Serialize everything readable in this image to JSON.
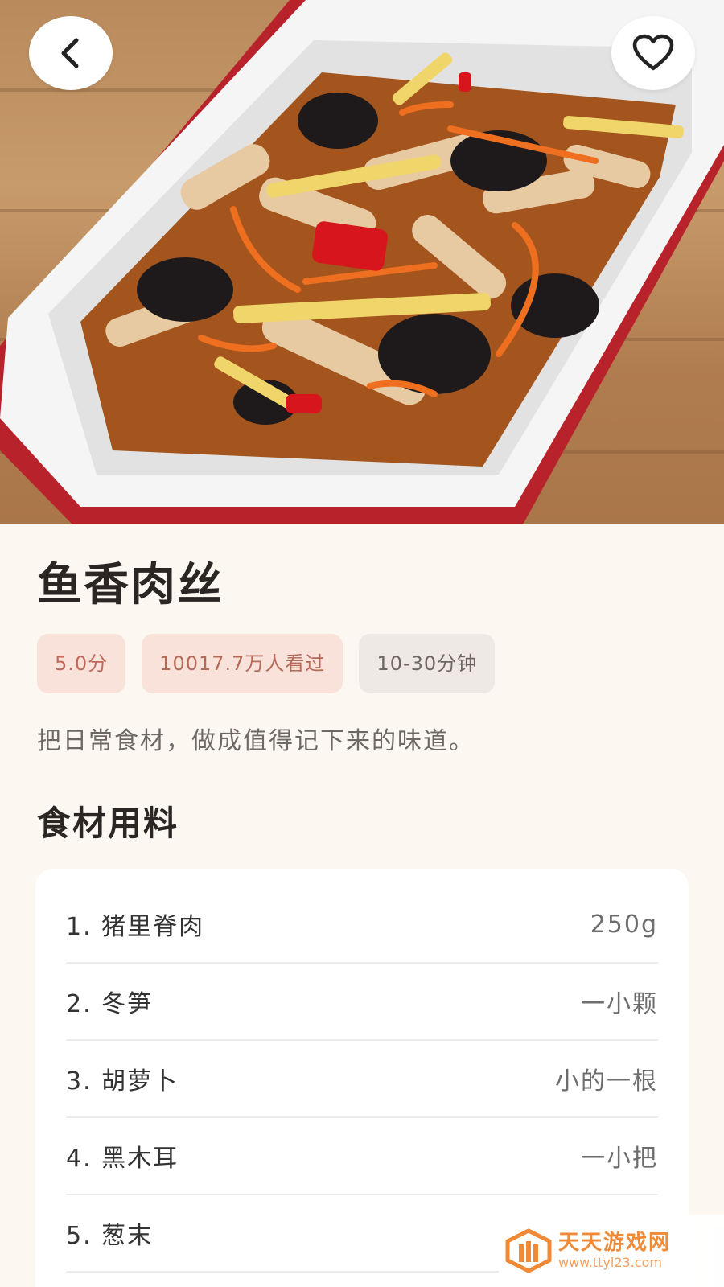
{
  "hero": {
    "image_alt": "鱼香肉丝"
  },
  "nav": {
    "back_icon": "chevron-left-icon",
    "favorite_icon": "heart-outline-icon"
  },
  "recipe": {
    "title": "鱼香肉丝",
    "tags": {
      "score": "5.0分",
      "views": "10017.7万人看过",
      "time": "10-30分钟"
    },
    "description": "把日常食材，做成值得记下来的味道。"
  },
  "ingredients": {
    "section_title": "食材用料",
    "items": [
      {
        "name": "1. 猪里脊肉",
        "amount": "250g"
      },
      {
        "name": "2. 冬笋",
        "amount": "一小颗"
      },
      {
        "name": "3. 胡萝卜",
        "amount": "小的一根"
      },
      {
        "name": "4. 黑木耳",
        "amount": "一小把"
      },
      {
        "name": "5. 葱末",
        "amount": ""
      }
    ]
  },
  "watermark": {
    "name": "天天游戏网",
    "url": "www.ttyl23.com"
  },
  "colors": {
    "page_bg": "#fdf7f2",
    "tag_accent_bg": "#f8e2da",
    "tag_accent_text": "#c0685a",
    "tag_neutral_bg": "#efe9e5",
    "watermark_orange": "#f08a36"
  }
}
